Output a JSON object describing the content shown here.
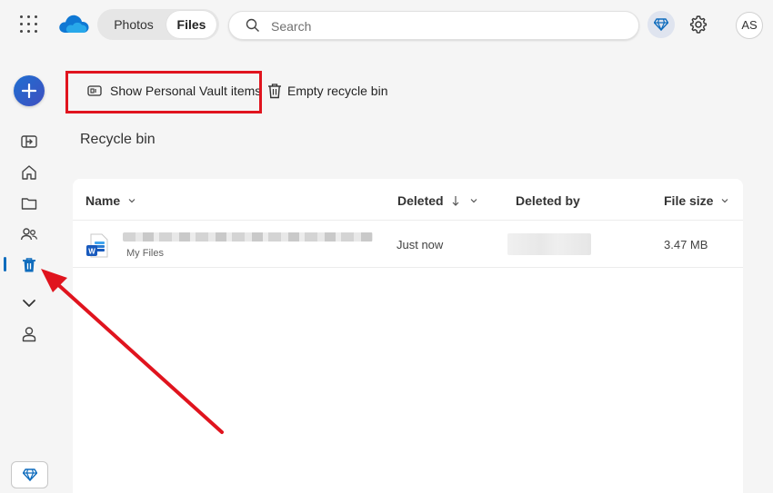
{
  "header": {
    "tabs": [
      {
        "label": "Photos",
        "selected": false
      },
      {
        "label": "Files",
        "selected": true
      }
    ],
    "search": {
      "placeholder": "Search"
    },
    "avatar_initials": "AS"
  },
  "commands": {
    "show_vault_label": "Show Personal Vault items",
    "empty_bin_label": "Empty recycle bin"
  },
  "page": {
    "title": "Recycle bin"
  },
  "table": {
    "columns": {
      "name": "Name",
      "deleted": "Deleted",
      "deleted_by": "Deleted by",
      "file_size": "File size"
    },
    "rows": [
      {
        "location": "My Files",
        "deleted": "Just now",
        "size": "3.47 MB",
        "file_type": "word-document-icon"
      }
    ]
  },
  "colors": {
    "accent": "#0f6cbd",
    "highlight": "#e0141e",
    "arrow": "#e0141e"
  }
}
